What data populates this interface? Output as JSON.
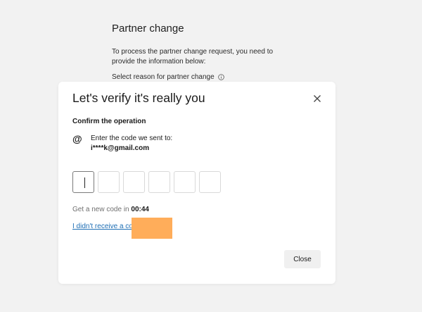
{
  "background_page": {
    "title": "Partner change",
    "description": "To process the partner change request, you need to provide the information below:",
    "reason_label": "Select reason for partner change",
    "info_icon": "info-icon"
  },
  "modal": {
    "title": "Let's verify it's really you",
    "close_icon": "close-icon",
    "section_label": "Confirm the operation",
    "contact_icon": "at-sign-icon",
    "sent_to_label": "Enter the code we sent to:",
    "email": "i****k@gmail.com",
    "code_digits": [
      "",
      "",
      "",
      "",
      "",
      ""
    ],
    "timer_prefix": "Get a new code in",
    "timer_value": "00:44",
    "resend_link": "I didn't receive a co",
    "close_button": "Close"
  },
  "colors": {
    "link": "#1f6fb5",
    "redaction": "#ffad5a",
    "page_bg": "#f2f2f2"
  }
}
